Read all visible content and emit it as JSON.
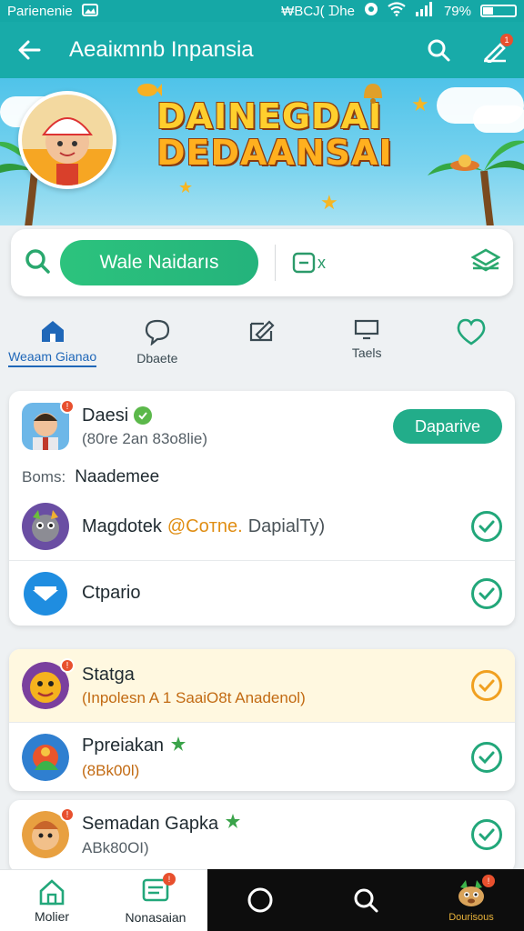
{
  "status_bar": {
    "left_text": "Parienenie",
    "center_text": "₩BCJ( ᗪhe",
    "battery": "79%"
  },
  "app_bar": {
    "title": "Aeaiкmnb Inpansia",
    "notification_count": "1"
  },
  "banner": {
    "title_line1": "DAINEGDAI",
    "title_line2": "DEDAANSAI"
  },
  "search": {
    "button_label": "Wale Naidarıs",
    "extra_label": "x"
  },
  "tabs": [
    {
      "label": "Weaam Gianao",
      "icon": "home-icon",
      "active": true
    },
    {
      "label": "Dbaete",
      "icon": "chat-icon",
      "active": false
    },
    {
      "label": "",
      "icon": "edit-icon",
      "active": false
    },
    {
      "label": "Taels",
      "icon": "monitor-icon",
      "active": false
    },
    {
      "label": "",
      "icon": "heart-icon",
      "active": false
    }
  ],
  "card1": {
    "rows": [
      {
        "name": "Daesi",
        "sub": "(80re 2an 83o8lie)",
        "action": "Daparive",
        "verified": true,
        "badge": "!"
      },
      {
        "label_key": "Boms:",
        "label_value": "Naademee"
      },
      {
        "name": "Magdotek",
        "inline_orange": "@Coтne.",
        "inline_muted": "DapialTy)",
        "checked": true
      },
      {
        "name": "Ctpario",
        "checked": true
      }
    ]
  },
  "card2": {
    "rows": [
      {
        "name": "Statga",
        "sub": "(Inpolesn A 1 SaaiO8t Anadenol)",
        "checked": true,
        "highlight": true,
        "badge": "!"
      },
      {
        "name": "Ppreiakan",
        "sub": "(8Bk00l)",
        "checked": true,
        "leaf": true
      }
    ]
  },
  "card3": {
    "rows": [
      {
        "name": "Semadan Gapka",
        "sub": "ABk80OI)",
        "checked": true,
        "leaf": true,
        "badge": "!"
      }
    ]
  },
  "bottom_nav": {
    "items": [
      {
        "label": "Molier",
        "icon": "home-icon"
      },
      {
        "label": "Nonasaian",
        "icon": "inbox-icon",
        "badge": "!"
      },
      {
        "label": "",
        "icon": "circle-icon"
      },
      {
        "label": "",
        "icon": "search-icon"
      },
      {
        "label": "Dourisous",
        "icon": "mascot-icon",
        "badge": "!"
      }
    ]
  },
  "colors": {
    "primary": "#18aba9",
    "accent_green": "#22ad8a",
    "check_green": "#22a77a",
    "warning_orange": "#f0a020",
    "badge_red": "#e8502e"
  }
}
